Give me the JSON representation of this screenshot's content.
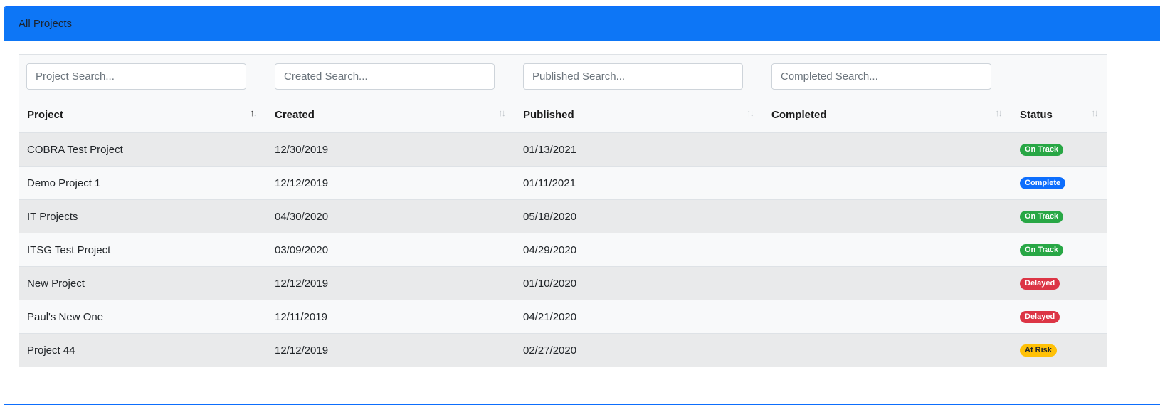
{
  "card": {
    "title": "All Projects"
  },
  "filters": [
    {
      "placeholder": "Project Search..."
    },
    {
      "placeholder": "Created Search..."
    },
    {
      "placeholder": "Published Search..."
    },
    {
      "placeholder": "Completed Search..."
    }
  ],
  "columns": [
    {
      "label": "Project",
      "sort_icon": "sort-arrows-icon"
    },
    {
      "label": "Created",
      "sort_icon": "sort-arrows-icon"
    },
    {
      "label": "Published",
      "sort_icon": "sort-arrows-icon"
    },
    {
      "label": "Completed",
      "sort_icon": "sort-arrows-icon"
    },
    {
      "label": "Status",
      "sort_icon": "sort-arrows-icon"
    }
  ],
  "rows": [
    {
      "project": "COBRA Test Project",
      "created": "12/30/2019",
      "published": "01/13/2021",
      "completed": "",
      "status": "On Track",
      "status_kind": "on-track"
    },
    {
      "project": "Demo Project 1",
      "created": "12/12/2019",
      "published": "01/11/2021",
      "completed": "",
      "status": "Complete",
      "status_kind": "complete"
    },
    {
      "project": "IT Projects",
      "created": "04/30/2020",
      "published": "05/18/2020",
      "completed": "",
      "status": "On Track",
      "status_kind": "on-track"
    },
    {
      "project": "ITSG Test Project",
      "created": "03/09/2020",
      "published": "04/29/2020",
      "completed": "",
      "status": "On Track",
      "status_kind": "on-track"
    },
    {
      "project": "New Project",
      "created": "12/12/2019",
      "published": "01/10/2020",
      "completed": "",
      "status": "Delayed",
      "status_kind": "delayed"
    },
    {
      "project": "Paul's New One",
      "created": "12/11/2019",
      "published": "04/21/2020",
      "completed": "",
      "status": "Delayed",
      "status_kind": "delayed"
    },
    {
      "project": "Project 44",
      "created": "12/12/2019",
      "published": "02/27/2020",
      "completed": "",
      "status": "At Risk",
      "status_kind": "at-risk"
    }
  ],
  "colors": {
    "header": "#0d76f6",
    "on_track": "#28a745",
    "complete": "#0d6efd",
    "delayed": "#dc3545",
    "at_risk": "#ffc107"
  }
}
